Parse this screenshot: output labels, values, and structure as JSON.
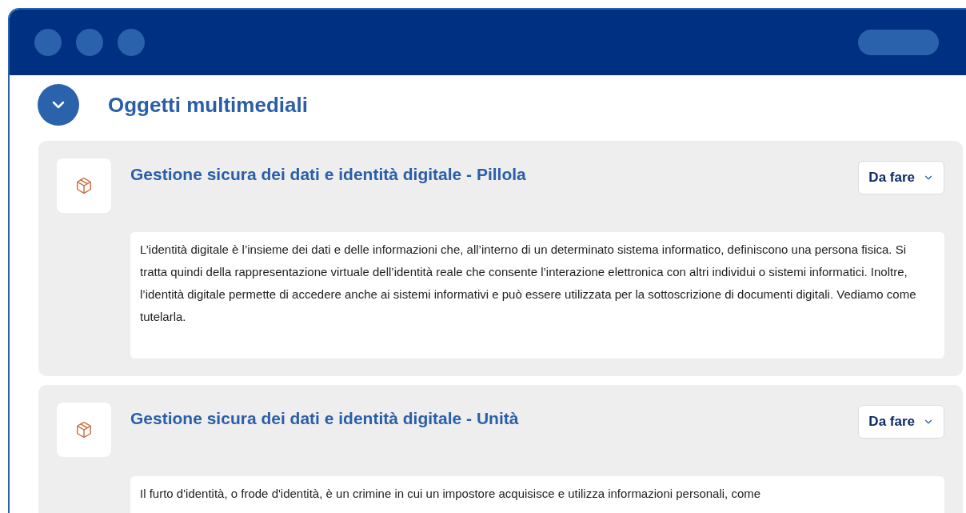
{
  "section": {
    "title": "Oggetti multimediali",
    "expanded": true
  },
  "items": [
    {
      "title": "Gestione sicura dei dati e identità digitale - Pillola",
      "status": "Da fare",
      "description": "L’identità digitale è l’insieme dei dati e delle informazioni che, all’interno di un determinato sistema informatico, definiscono una persona fisica. Si tratta quindi della rappresentazione virtuale dell’identità reale che consente l’interazione elettronica con altri individui o sistemi informatici. Inoltre, l’identità digitale permette di accedere anche ai sistemi informativi e può essere utilizzata per la sottoscrizione di documenti digitali. Vediamo come tutelarla."
    },
    {
      "title": "Gestione sicura dei dati e identità digitale - Unità",
      "status": "Da fare",
      "description": "Il furto d'identità, o frode d'identità, è un crimine in cui un impostore acquisisce e utilizza informazioni personali, come"
    }
  ]
}
